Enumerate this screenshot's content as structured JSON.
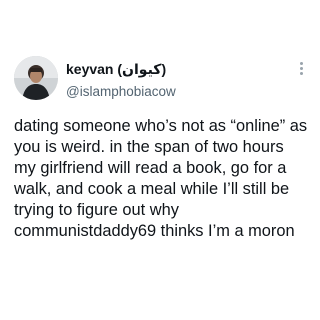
{
  "tweet": {
    "display_name": "keyvan (کیوان)",
    "handle": "@islamphobiacow",
    "text": "dating someone who’s not as “online” as you is weird. in the span of two hours my girlfriend will read a book, go for a walk, and cook a meal while I’ll still be trying to figure out why communistdaddy69 thinks I’m a moron"
  },
  "icons": {
    "avatar": "profile-photo",
    "more": "more-options-vertical-dots"
  },
  "colors": {
    "background": "#ffffff",
    "text_primary": "#0f1419",
    "text_secondary": "#536471"
  }
}
